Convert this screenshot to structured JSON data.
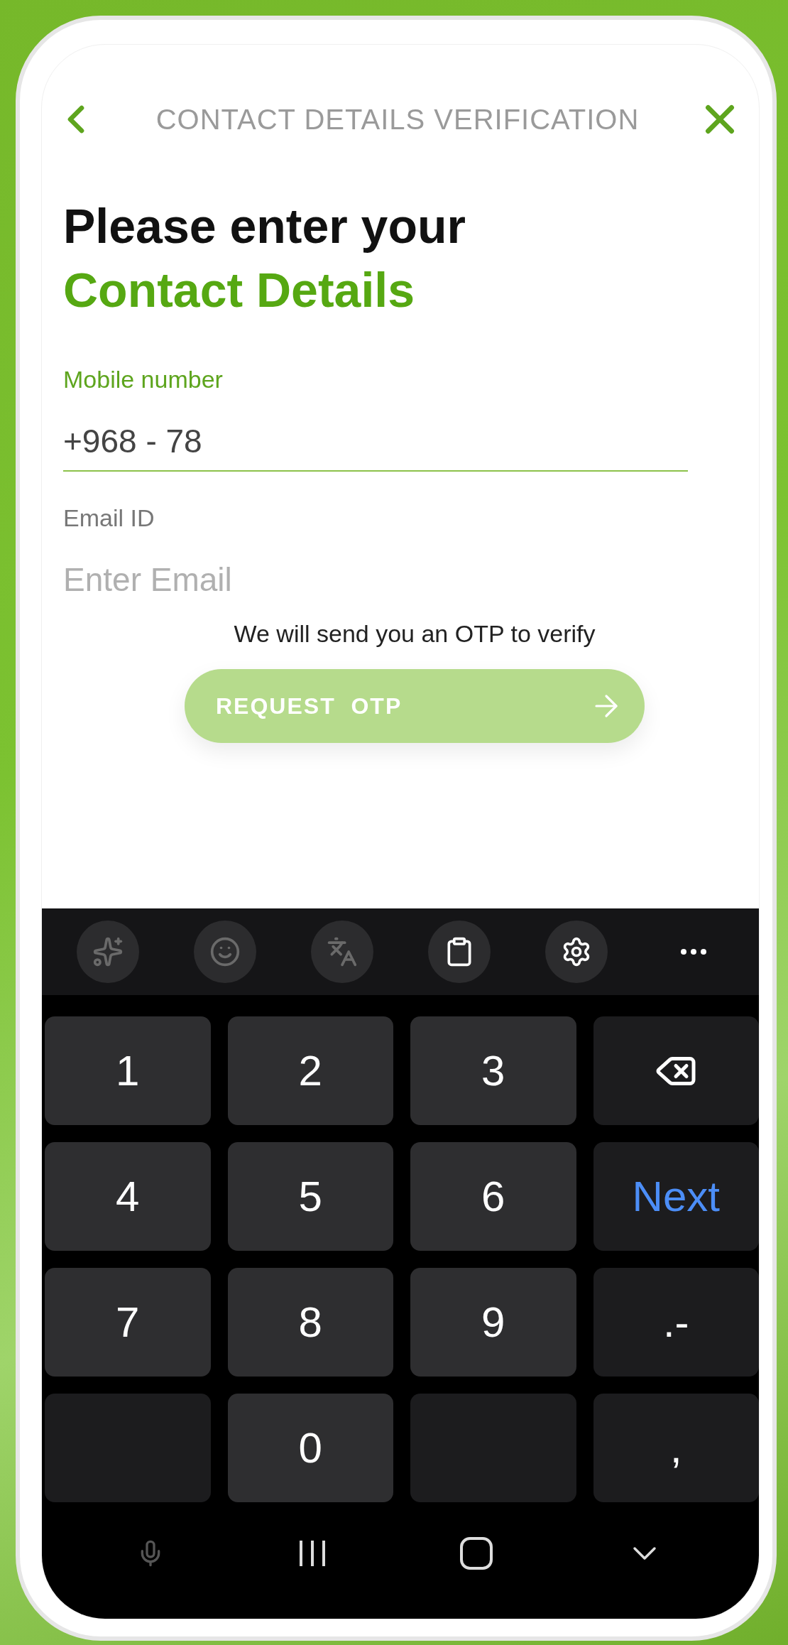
{
  "header": {
    "title": "CONTACT DETAILS VERIFICATION"
  },
  "heading": {
    "line1": "Please enter your",
    "line2": "Contact Details"
  },
  "fields": [
    {
      "label": "Mobile number",
      "value": "+968 - 78",
      "focused": true
    },
    {
      "label": "Email ID",
      "placeholder": "Enter Email",
      "focused": false
    }
  ],
  "hint": "We will send you an OTP to verify",
  "request_button": {
    "label": "REQUEST  OTP",
    "disabled": true
  },
  "keyboard": {
    "toolbar": [
      {
        "kind": "sparkle",
        "disabled": true
      },
      {
        "kind": "emoji",
        "disabled": true
      },
      {
        "kind": "translate",
        "disabled": true
      },
      {
        "kind": "clipboard",
        "disabled": false
      },
      {
        "kind": "settings",
        "disabled": false
      },
      {
        "kind": "more",
        "disabled": false
      }
    ],
    "rows": [
      [
        {
          "kind": "digit",
          "label": "1"
        },
        {
          "kind": "digit",
          "label": "2"
        },
        {
          "kind": "digit",
          "label": "3"
        },
        {
          "kind": "backspace"
        }
      ],
      [
        {
          "kind": "digit",
          "label": "4"
        },
        {
          "kind": "digit",
          "label": "5"
        },
        {
          "kind": "digit",
          "label": "6"
        },
        {
          "kind": "action",
          "label": "Next"
        }
      ],
      [
        {
          "kind": "digit",
          "label": "7"
        },
        {
          "kind": "digit",
          "label": "8"
        },
        {
          "kind": "digit",
          "label": "9"
        },
        {
          "kind": "symbol",
          "label": ".-"
        }
      ],
      [
        {
          "kind": "blank"
        },
        {
          "kind": "digit",
          "label": "0"
        },
        {
          "kind": "blank"
        },
        {
          "kind": "symbol",
          "label": ","
        }
      ]
    ]
  },
  "nav_bar": [
    {
      "kind": "mic"
    },
    {
      "kind": "recents"
    },
    {
      "kind": "home"
    },
    {
      "kind": "hide"
    }
  ]
}
